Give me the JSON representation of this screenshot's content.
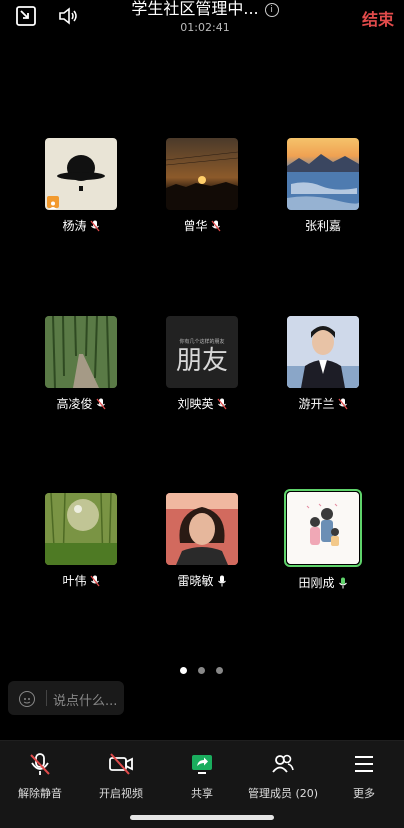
{
  "header": {
    "title": "学生社区管理中...",
    "timer": "01:02:41",
    "end_label": "结束"
  },
  "participants": [
    {
      "name": "杨涛",
      "mic": "muted"
    },
    {
      "name": "曾华",
      "mic": "muted"
    },
    {
      "name": "张利嘉",
      "mic": "none"
    },
    {
      "name": "高凌俊",
      "mic": "muted"
    },
    {
      "name": "刘映英",
      "mic": "muted"
    },
    {
      "name": "游开兰",
      "mic": "muted"
    },
    {
      "name": "叶伟",
      "mic": "muted"
    },
    {
      "name": "雷晓敏",
      "mic": "on"
    },
    {
      "name": "田刚成",
      "mic": "speaking"
    }
  ],
  "avatar_overlay_text": {
    "t5_main": "朋友",
    "t5_small": "你有几个这样的朋友"
  },
  "pager": {
    "count": 3,
    "active": 0
  },
  "chat": {
    "placeholder": "说点什么..."
  },
  "toolbar": {
    "unmute_label": "解除静音",
    "video_label": "开启视频",
    "share_label": "共享",
    "members_label": "管理成员 (20)",
    "more_label": "更多"
  },
  "colors": {
    "accent_end": "#e14b4b",
    "speaking": "#5fd36b",
    "share_green": "#1aad5e"
  }
}
